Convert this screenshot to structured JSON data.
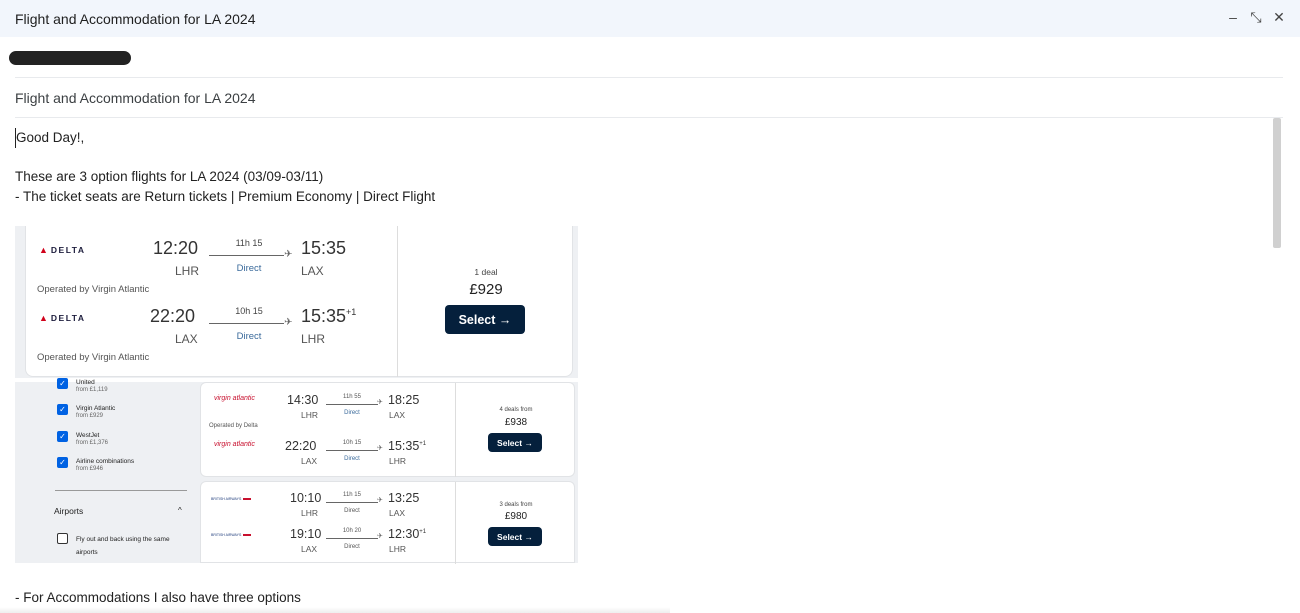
{
  "window": {
    "title": "Flight and Accommodation for LA 2024",
    "controls": {
      "minimize": "–",
      "exit_full": "⤡",
      "close": "✕"
    }
  },
  "subject": "Flight and Accommodation for LA 2024",
  "body": {
    "greeting": "Good Day!,",
    "line1": "These are 3 option flights for LA 2024 (03/09-03/11)",
    "line2": "- The ticket seats are Return tickets | Premium Economy | Direct Flight",
    "footer": "- For Accommodations I also have three options"
  },
  "option1": {
    "airline": "DELTA",
    "outbound": {
      "depart": "12:20",
      "depart_code": "LHR",
      "duration": "11h 15",
      "stops": "Direct",
      "arrive": "15:35",
      "arrive_code": "LAX",
      "operated": "Operated by Virgin Atlantic"
    },
    "inbound": {
      "depart": "22:20",
      "depart_code": "LAX",
      "duration": "10h 15",
      "stops": "Direct",
      "arrive": "15:35",
      "arrive_sup": "+1",
      "arrive_code": "LHR",
      "operated": "Operated by Virgin Atlantic"
    },
    "deals": "1 deal",
    "price": "£929",
    "select": "Select →"
  },
  "filters": [
    {
      "label": "United",
      "sub": "from £1,119"
    },
    {
      "label": "Virgin Atlantic",
      "sub": "from £929"
    },
    {
      "label": "WestJet",
      "sub": "from £1,376"
    },
    {
      "label": "Airline combinations",
      "sub": "from £946"
    }
  ],
  "airports_filter": {
    "heading": "Airports",
    "caret": "^",
    "option": "Fly out and back using the same airports"
  },
  "option2": {
    "airline_logo": "virgin atlantic",
    "outbound": {
      "depart": "14:30",
      "depart_code": "LHR",
      "duration": "11h 55",
      "stops": "Direct",
      "arrive": "18:25",
      "arrive_code": "LAX"
    },
    "operated": "Operated by Delta",
    "inbound": {
      "depart": "22:20",
      "depart_code": "LAX",
      "duration": "10h 15",
      "stops": "Direct",
      "arrive": "15:35",
      "arrive_sup": "+1",
      "arrive_code": "LHR"
    },
    "deals": "4 deals from",
    "price": "£938",
    "select": "Select →"
  },
  "option3": {
    "airline_logo": "BRITISH AIRWAYS",
    "outbound": {
      "depart": "10:10",
      "depart_code": "LHR",
      "duration": "11h 15",
      "stops": "Direct",
      "arrive": "13:25",
      "arrive_code": "LAX"
    },
    "inbound": {
      "depart": "19:10",
      "depart_code": "LAX",
      "duration": "10h 20",
      "stops": "Direct",
      "arrive": "12:30",
      "arrive_sup": "+1",
      "arrive_code": "LHR"
    },
    "deals": "3 deals from",
    "price": "£980",
    "select": "Select →"
  },
  "colors": {
    "titlebar_bg": "#f2f6fc",
    "select_btn": "#05203c",
    "delta_red": "#d0021b",
    "checkbox": "#0062e3"
  }
}
